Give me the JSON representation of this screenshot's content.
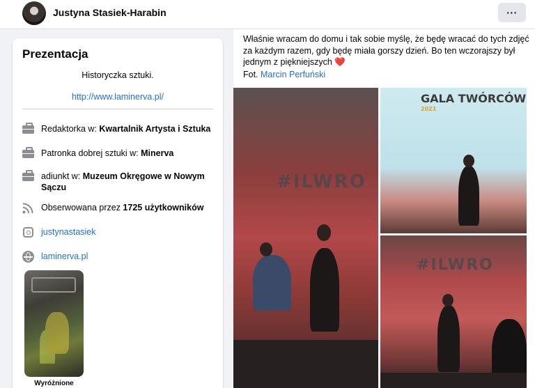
{
  "header": {
    "name": "Justyna Stasiek-Harabin",
    "more_label": "···"
  },
  "intro": {
    "title": "Prezentacja",
    "bio": "Historyczka sztuki.",
    "website_link": "http://www.laminerva.pl/",
    "rows": [
      {
        "icon": "briefcase-icon",
        "prefix": "Redaktorka w: ",
        "bold": "Kwartalnik Artysta i Sztuka"
      },
      {
        "icon": "briefcase-icon",
        "prefix": "Patronka dobrej sztuki w: ",
        "bold": "Minerva"
      },
      {
        "icon": "briefcase-icon",
        "prefix": "adiunkt w: ",
        "bold": "Muzeum Okręgowe w Nowym Sączu"
      },
      {
        "icon": "rss-icon",
        "prefix": "Obserwowana przez ",
        "bold": "1725 użytkowników"
      }
    ],
    "instagram": "justynastasiek",
    "website": "laminerva.pl",
    "featured_label": "Wyróżnione"
  },
  "post": {
    "text": "Właśnie wracam do domu i tak sobie myślę, że będę wracać do tych zdjęć za każdym razem, gdy będę miała gorszy dzień. Bo ten wczorajszy był jednym z piękniejszych",
    "heart": "❤️",
    "credit_prefix": "Fot. ",
    "credit_name": "Marcin Perfuński",
    "photo_text_1": "#ILWRO",
    "photo_text_2": "GALA TWÓRCÓW",
    "photo_text_3": "#ILWRO"
  },
  "colors": {
    "link": "#216fdb",
    "accent_bg": "#f0f2f5",
    "icon_gray": "#8a8d91"
  }
}
